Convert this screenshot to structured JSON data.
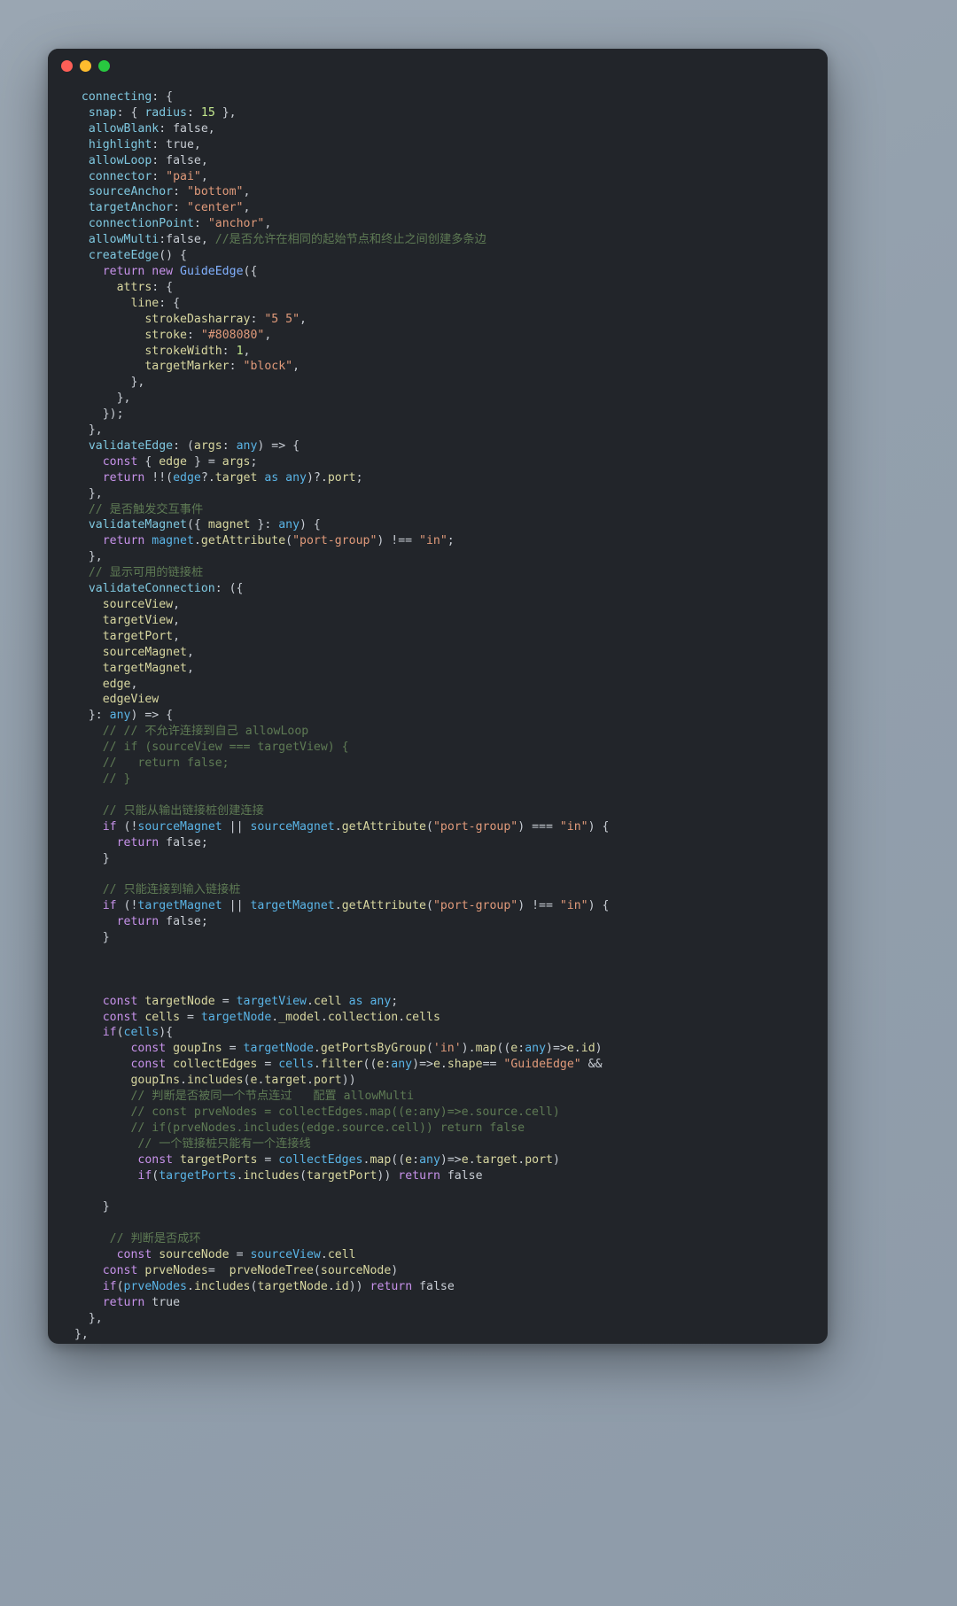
{
  "window": {
    "title": "",
    "traffic_lights": [
      {
        "name": "close-button",
        "color": "#ff5f57"
      },
      {
        "name": "minimize-button",
        "color": "#febc2e"
      },
      {
        "name": "zoom-button",
        "color": "#28c840"
      }
    ],
    "background": "#22252a",
    "desktop_background": "#97a3b0"
  },
  "editor": {
    "language": "typescript",
    "theme_colors": {
      "background": "#22252a",
      "foreground": "#c8cdd4",
      "property": "#7fc8e0",
      "identifier": "#d8d7a0",
      "keyword": "#c792ea",
      "string": "#e09a7a",
      "number": "#c3e88d",
      "comment": "#5e7a54",
      "class": "#82b1ff",
      "type": "#5ab4e6"
    },
    "code_lines": [
      "  connecting: {",
      "   snap: { radius: 15 },",
      "   allowBlank: false,",
      "   highlight: true,",
      "   allowLoop: false,",
      "   connector: \"pai\",",
      "   sourceAnchor: \"bottom\",",
      "   targetAnchor: \"center\",",
      "   connectionPoint: \"anchor\",",
      "   allowMulti:false, //是否允许在相同的起始节点和终止之间创建多条边",
      "   createEdge() {",
      "     return new GuideEdge({",
      "       attrs: {",
      "         line: {",
      "           strokeDasharray: \"5 5\",",
      "           stroke: \"#808080\",",
      "           strokeWidth: 1,",
      "           targetMarker: \"block\",",
      "         },",
      "       },",
      "     });",
      "   },",
      "   validateEdge: (args: any) => {",
      "     const { edge } = args;",
      "     return !!(edge?.target as any)?.port;",
      "   },",
      "   // 是否触发交互事件",
      "   validateMagnet({ magnet }: any) {",
      "     return magnet.getAttribute(\"port-group\") !== \"in\";",
      "   },",
      "   // 显示可用的链接桩",
      "   validateConnection: ({",
      "     sourceView,",
      "     targetView,",
      "     targetPort,",
      "     sourceMagnet,",
      "     targetMagnet,",
      "     edge,",
      "     edgeView",
      "   }: any) => {",
      "     // // 不允许连接到自己 allowLoop",
      "     // if (sourceView === targetView) {",
      "     //   return false;",
      "     // }",
      "",
      "     // 只能从输出链接桩创建连接",
      "     if (!sourceMagnet || sourceMagnet.getAttribute(\"port-group\") === \"in\") {",
      "       return false;",
      "     }",
      "",
      "     // 只能连接到输入链接桩",
      "     if (!targetMagnet || targetMagnet.getAttribute(\"port-group\") !== \"in\") {",
      "       return false;",
      "     }",
      "",
      "",
      "",
      "     const targetNode = targetView.cell as any;",
      "     const cells = targetNode._model.collection.cells",
      "     if(cells){",
      "         const goupIns = targetNode.getPortsByGroup('in').map((e:any)=>e.id)",
      "         const collectEdges = cells.filter((e:any)=>e.shape== \"GuideEdge\" &&",
      "         goupIns.includes(e.target.port))",
      "         // 判断是否被同一个节点连过   配置 allowMulti",
      "         // const prveNodes = collectEdges.map((e:any)=>e.source.cell)",
      "         // if(prveNodes.includes(edge.source.cell)) return false",
      "          // 一个链接桩只能有一个连接线",
      "          const targetPorts = collectEdges.map((e:any)=>e.target.port)",
      "          if(targetPorts.includes(targetPort)) return false",
      "",
      "     }",
      "",
      "      // 判断是否成环",
      "       const sourceNode = sourceView.cell",
      "     const prveNodes=  prveNodeTree(sourceNode)",
      "     if(prveNodes.includes(targetNode.id)) return false",
      "     return true",
      "   },",
      " },"
    ]
  }
}
